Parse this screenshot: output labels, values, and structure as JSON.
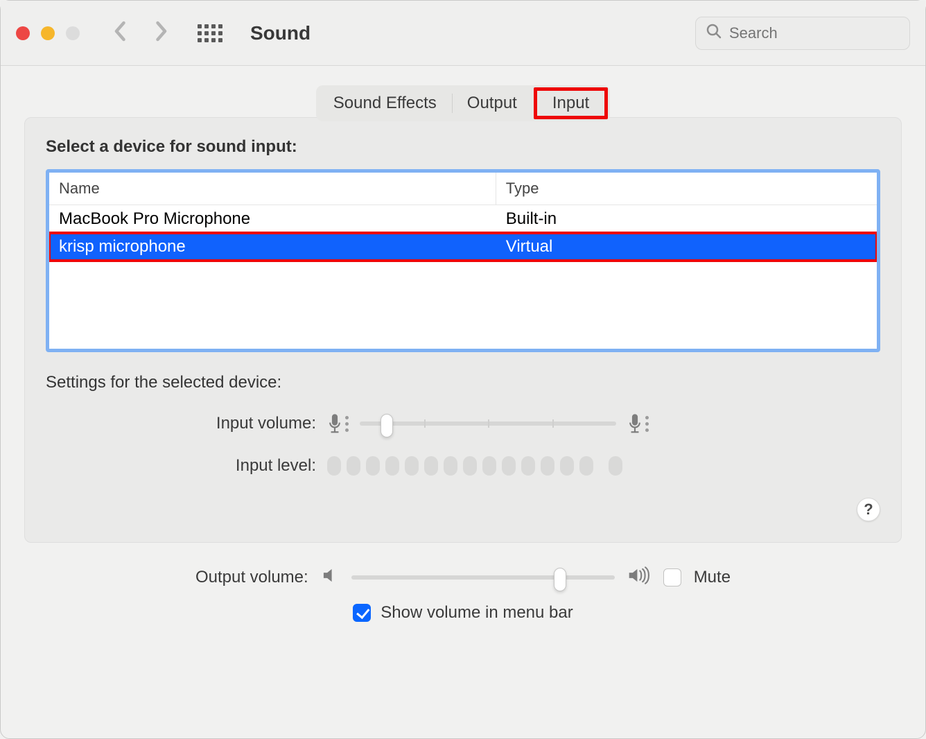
{
  "window": {
    "title": "Sound",
    "search_placeholder": "Search"
  },
  "tabs": {
    "effects": "Sound Effects",
    "output": "Output",
    "input": "Input",
    "active": "Input"
  },
  "input_panel": {
    "heading": "Select a device for sound input:",
    "columns": {
      "name": "Name",
      "type": "Type"
    },
    "devices": [
      {
        "name": "MacBook Pro Microphone",
        "type": "Built-in",
        "selected": false
      },
      {
        "name": "krisp microphone",
        "type": "Virtual",
        "selected": true
      }
    ],
    "settings_heading": "Settings for the selected device:",
    "input_volume_label": "Input volume:",
    "input_level_label": "Input level:",
    "input_volume_value": 0.08,
    "input_level_segments": 15,
    "help_label": "?"
  },
  "output": {
    "label": "Output volume:",
    "mute_label": "Mute",
    "mute_checked": false,
    "value": 0.77
  },
  "menubar": {
    "checked": true,
    "label": "Show volume in menu bar"
  }
}
